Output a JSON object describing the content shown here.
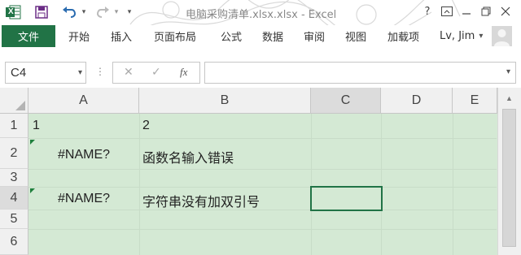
{
  "app": {
    "window_title": "电脑采购清单.xlsx.xlsx - Excel",
    "accent_color": "#217346"
  },
  "quick_access": {
    "app_icon": "excel-logo-icon",
    "logo_letter": "X",
    "save_icon": "save-icon",
    "undo_icon": "undo-icon",
    "redo_icon": "redo-icon",
    "customize_icon": "customize-quick-access-icon"
  },
  "window_controls": {
    "help": "?",
    "ribbon_options": "ribbon-display-options-icon",
    "minimize": "minimize-icon",
    "restore": "restore-icon",
    "close": "close-icon"
  },
  "ribbon": {
    "file_tab": "文件",
    "tabs": [
      "开始",
      "插入",
      "页面布局",
      "公式",
      "数据",
      "审阅",
      "视图",
      "加载项"
    ],
    "user": "Lv, Jim",
    "user_dropdown": "▾"
  },
  "formula_bar": {
    "name_box": "C4",
    "cancel_icon": "cancel-icon",
    "enter_icon": "enter-icon",
    "function_icon": "fx",
    "formula": ""
  },
  "sheet": {
    "columns": [
      "A",
      "B",
      "C",
      "D",
      "E"
    ],
    "rows": [
      "1",
      "2",
      "3",
      "4",
      "5",
      "6"
    ],
    "selected_cell": "C4",
    "cells": {
      "A1": "1",
      "B1": "2",
      "A2": "#NAME?",
      "B2": "函数名输入错误",
      "A4": "#NAME?",
      "B4": "字符串没有加双引号"
    },
    "error_indicator_cells": [
      "A2",
      "A4"
    ],
    "background_color": "#d4e9d4"
  }
}
